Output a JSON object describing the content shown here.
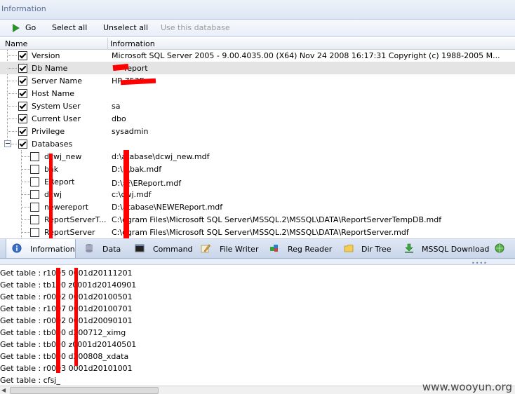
{
  "window": {
    "title": "Information"
  },
  "toolbar": {
    "go": "Go",
    "select_all": "Select all",
    "unselect_all": "Unselect all",
    "use_database": "Use this database"
  },
  "grid": {
    "columns": {
      "name": "Name",
      "info": "Information"
    },
    "rows": [
      {
        "name": "Version",
        "info": "Microsoft SQL Server 2005 - 9.00.4035.00 (X64) Nov 24 2008 16:17:31 Copyright (c) 1988-2005 M..."
      },
      {
        "name": "Db Name",
        "info": "report"
      },
      {
        "name": "Server Name",
        "info": "HP-753E"
      },
      {
        "name": "Host Name",
        "info": ""
      },
      {
        "name": "System User",
        "info": "sa"
      },
      {
        "name": "Current User",
        "info": "dbo"
      },
      {
        "name": "Privilege",
        "info": "sysadmin"
      },
      {
        "name": "Databases",
        "info": ""
      }
    ],
    "databases": [
      {
        "name": "dcwj_new",
        "info": "d:\\atabase\\dcwj_new.mdf"
      },
      {
        "name": "bak",
        "info": "D:\\k\\bak.mdf"
      },
      {
        "name": "EReport",
        "info": "D:\\表\\EReport.mdf"
      },
      {
        "name": "dcwj",
        "info": "c:\\cwj.mdf"
      },
      {
        "name": "newereport",
        "info": "D:\\atabase\\NEWEReport.mdf"
      },
      {
        "name": "ReportServerT...",
        "info": "C:\\ogram Files\\Microsoft SQL Server\\MSSQL.2\\MSSQL\\DATA\\ReportServerTempDB.mdf"
      },
      {
        "name": "ReportServer",
        "info": "C:\\ogram Files\\Microsoft SQL Server\\MSSQL.2\\MSSQL\\DATA\\ReportServer.mdf"
      }
    ]
  },
  "tabs": [
    {
      "label": "Information",
      "icon": "info-icon"
    },
    {
      "label": "Data",
      "icon": "database-icon"
    },
    {
      "label": "Command",
      "icon": "terminal-icon"
    },
    {
      "label": "File Writer",
      "icon": "pencil-icon"
    },
    {
      "label": "Reg Reader",
      "icon": "registry-icon"
    },
    {
      "label": "Dir Tree",
      "icon": "folder-icon"
    },
    {
      "label": "MSSQL Download",
      "icon": "download-icon"
    },
    {
      "label": "",
      "icon": "globe-icon"
    }
  ],
  "log": [
    "Get table : r1005 0001d20111201",
    "Get table : tb100 z0001d20140901",
    "Get table : r0002 0001d20100501",
    "Get table : r1007 0001d20100701",
    "Get table : r0002 0001d20090101",
    "Get table : tb000 d200712_ximg",
    "Get table : tb000 z0001d20140501",
    "Get table : tb000 d200808_xdata",
    "Get table : r0003 0001d20101001",
    "Get table : cfsj_"
  ],
  "watermark": "www.wooyun.org",
  "colors": {
    "accent": "#dde6f4",
    "redaction": "#ff0000",
    "go": "#2f8f2f"
  }
}
